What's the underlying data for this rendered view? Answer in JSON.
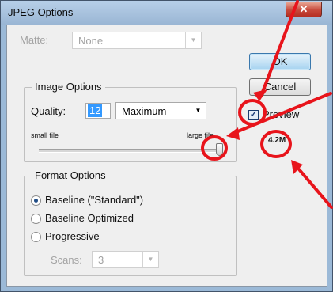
{
  "window": {
    "title": "JPEG Options",
    "close_glyph": "✕"
  },
  "matte": {
    "label": "Matte:",
    "value": "None"
  },
  "image_options": {
    "legend": "Image Options",
    "quality_label": "Quality:",
    "quality_value": "12",
    "preset_value": "Maximum",
    "small_label": "small file",
    "large_label": "large file",
    "slider_level": 1.0
  },
  "format_options": {
    "legend": "Format Options",
    "options": [
      "Baseline (\"Standard\")",
      "Baseline Optimized",
      "Progressive"
    ],
    "selected_index": 0,
    "scans_label": "Scans:",
    "scans_value": "3"
  },
  "buttons": {
    "ok": "OK",
    "cancel": "Cancel"
  },
  "preview": {
    "label": "Preview",
    "checked": true,
    "check_glyph": "✓"
  },
  "file_size": "4.2M",
  "annotation_color": "#e8141b"
}
